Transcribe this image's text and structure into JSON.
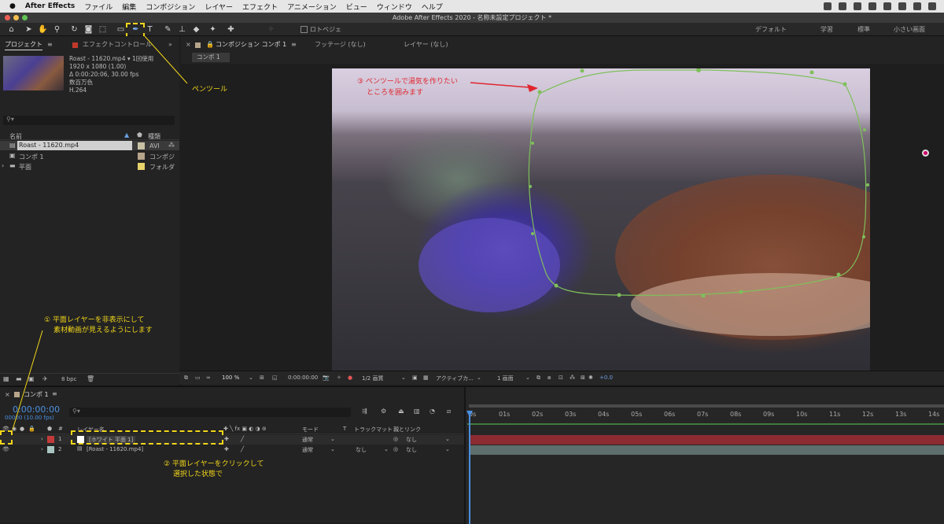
{
  "menubar": {
    "apple": "",
    "app": "After Effects",
    "items": [
      "ファイル",
      "編集",
      "コンポジション",
      "レイヤー",
      "エフェクト",
      "アニメーション",
      "ビュー",
      "ウィンドウ",
      "ヘルプ"
    ]
  },
  "window_title": "Adobe After Effects 2020 - 名称未設定プロジェクト *",
  "toolbar": {
    "roto_label": "ロトベジェ",
    "workspaces": [
      "デフォルト",
      "学習",
      "標準",
      "小さい画面"
    ]
  },
  "project_panel": {
    "tab_project": "プロジェクト",
    "tab_effects": "エフェクトコントロール",
    "footage_name": "Roast - 11620.mp4 ▾ 1回使用",
    "footage_info": [
      "1920 x 1080 (1.00)",
      "Δ 0:00:20:06, 30.00 fps",
      "数百万色",
      "H.264"
    ],
    "search_placeholder": "",
    "col_name": "名前",
    "col_type": "種類",
    "items": [
      {
        "name": "Roast - 11620.mp4",
        "type": "AVI",
        "color": "#c9c1a4"
      },
      {
        "name": "コンポ 1",
        "type": "コンポジ",
        "color": "#b7a58b"
      },
      {
        "name": "平面",
        "type": "フォルダ",
        "color": "#e8d36a"
      }
    ],
    "bpc": "8 bpc"
  },
  "comp_panel": {
    "tab_comp": "コンポジション コンポ 1",
    "tab_footage": "フッテージ (なし)",
    "tab_layer": "レイヤー (なし)",
    "subtab": "コンポ 1",
    "zoom": "100 %",
    "timecode": "0:00:00:00",
    "resolution": "1/2 画質",
    "view": "アクティブカ...",
    "views": "1 画面",
    "exposure": "+0.0"
  },
  "timeline": {
    "tab": "コンポ 1",
    "timecode": "0:00:00:00",
    "fps_note": "00000 (10.00 fps)",
    "col_layer": "レイヤー名",
    "col_mode": "モード",
    "col_t": "T",
    "col_track": "トラックマット",
    "col_parent": "親とリンク",
    "layers": [
      {
        "num": "1",
        "name": "[ホワイト 平面 1]",
        "mode": "通常",
        "track": "",
        "parent": "なし",
        "color": "#c23b3b",
        "thumb": "#ffffff"
      },
      {
        "num": "2",
        "name": "[Roast - 11620.mp4]",
        "mode": "通常",
        "track": "なし",
        "parent": "なし",
        "color": "#a9c6c1",
        "thumb": "#9bb"
      }
    ],
    "ruler": [
      "0s",
      "01s",
      "02s",
      "03s",
      "04s",
      "05s",
      "06s",
      "07s",
      "08s",
      "09s",
      "10s",
      "11s",
      "12s",
      "13s",
      "14s"
    ]
  },
  "annotations": {
    "pen": "ペンツール",
    "step1_line1": "① 平面レイヤーを非表示にして",
    "step1_line2": "素材動画が見えるようにします",
    "step2_line1": "② 平面レイヤーをクリックして",
    "step2_line2": "選択した状態で",
    "step3_line1": "③ ペンツールで湯気を作りたい",
    "step3_line2": "ところを囲みます"
  },
  "colors": {
    "accent": "#f2d61a",
    "mask": "#7fbf5a",
    "timecode_blue": "#4a8fe0",
    "annotation_red": "#e0262f"
  }
}
